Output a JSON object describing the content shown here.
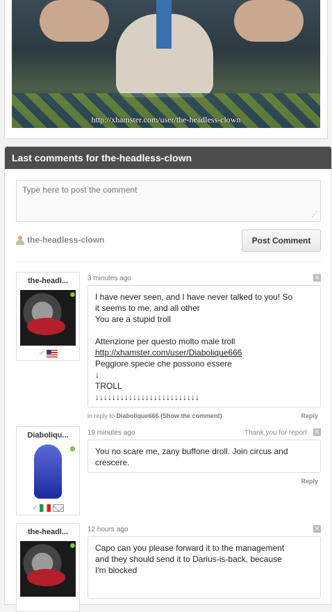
{
  "top_image": {
    "caption": "http://xhamster.com/user/the-headless-clown"
  },
  "panel": {
    "title": "Last comments for the-headless-clown",
    "placeholder": "Type here to post the comment",
    "current_user": "the-headless-clown",
    "post_label": "Post Comment"
  },
  "comments": [
    {
      "author": "the-headl...",
      "time": "3 minutes ago",
      "lines": [
        "I have never seen, and I have never talked to you! So",
        "it seems to me, and all other",
        "You are a stupid troll",
        "",
        "Attenzione per questo molto male troll"
      ],
      "link": "http://xhamster.com/user/Diabolique666",
      "lines2": [
        "Peggiore specie che possono essere",
        "↓",
        "TROLL",
        "↓↓↓↓↓↓↓↓↓↓↓↓↓↓↓↓↓↓↓↓↓↓↓↓↓"
      ],
      "reply_prefix": "in reply to",
      "reply_to": "Diabolique666 (Show the comment)",
      "reply_label": "Reply"
    },
    {
      "author": "Diaboliqu...",
      "time": "19 minutes ago",
      "report": "Thank you for report",
      "lines": [
        "You no scare me, zany buffone droll. Join circus and",
        "crescere."
      ],
      "reply_label": "Reply"
    },
    {
      "author": "the-headl...",
      "time": "12 hours ago",
      "lines": [
        "Capo can you please forward it to the management",
        "and they should send it to Darius-is-back, because",
        "I'm blocked"
      ]
    }
  ],
  "colors": {
    "header_bg": "#4d4d4d",
    "online": "#8fcf4a",
    "gender": "#2f8ad8"
  },
  "icons": {
    "gender": "male-symbol",
    "close": "close-x"
  }
}
